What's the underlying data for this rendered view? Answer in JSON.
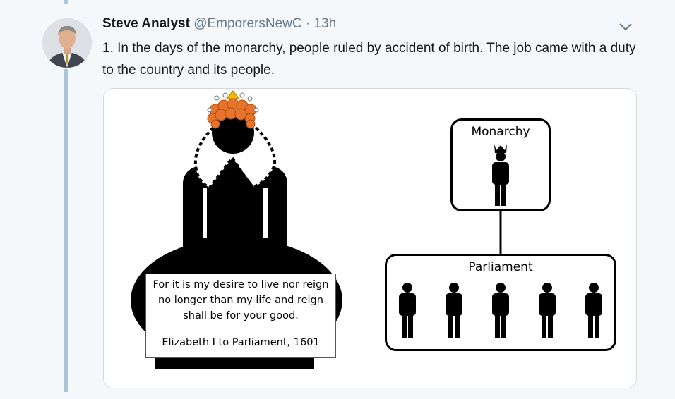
{
  "tweet": {
    "author_name": "Steve Analyst",
    "handle": "@EmporersNewC",
    "separator": "·",
    "time": "13h",
    "text": "1. In the days of the monarchy, people ruled by accident of birth. The job came with a duty to the country and its people."
  },
  "icons": {
    "menu": "chevron-down-icon",
    "avatar": "avatar"
  },
  "image": {
    "quote_line1": "For it is my desire to live nor reign",
    "quote_line2": "no longer than my life and reign",
    "quote_line3": "shall be for your good.",
    "quote_attribution": "Elizabeth I to Parliament, 1601",
    "monarchy_label": "Monarchy",
    "parliament_label": "Parliament"
  },
  "colors": {
    "thread_line": "#a9c6d6",
    "hair": "#e8732a",
    "crown": "#f2b705",
    "text": "#14171a",
    "muted": "#657786"
  }
}
